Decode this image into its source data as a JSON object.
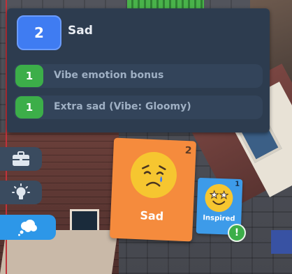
{
  "tooltip": {
    "count": "2",
    "title": "Sad",
    "rows": [
      {
        "count": "1",
        "label": "Vibe emotion bonus"
      },
      {
        "count": "1",
        "label": "Extra sad (Vibe: Gloomy)"
      }
    ]
  },
  "side_buttons": [
    {
      "icon": "briefcase-icon"
    },
    {
      "icon": "lightbulb-icon"
    },
    {
      "icon": "thought-bubble-icon"
    }
  ],
  "cards": {
    "sad": {
      "count": "2",
      "label": "Sad",
      "icon": "crying-face-icon",
      "color": "#f58b3d"
    },
    "inspired": {
      "count": "1",
      "label": "Inspired",
      "icon": "star-eyes-face-icon",
      "color": "#3d9be9"
    }
  },
  "alert": {
    "symbol": "!"
  },
  "colors": {
    "panel": "#2d3c4f",
    "count_badge": "#3f7cf2",
    "row_badge": "#3cae49",
    "side_button_active": "#2d97e8"
  }
}
